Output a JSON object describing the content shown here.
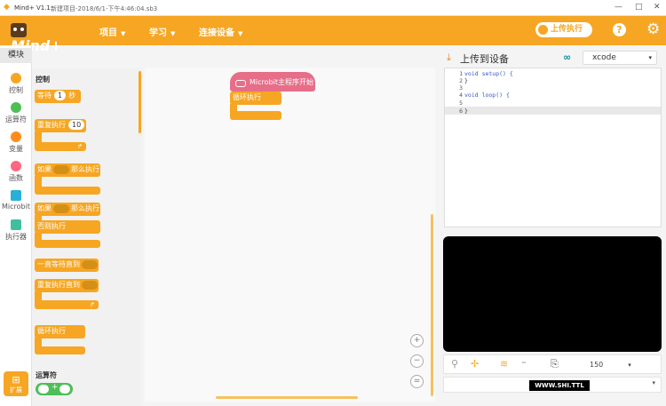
{
  "window": {
    "app_title": "Mind+ V1.1",
    "project_title": "新建项目-2018/6/1-下午4:46:04.sb3",
    "controls": [
      "—",
      "□",
      "✕"
    ]
  },
  "menubar": {
    "logo_text": "Mind+",
    "menus": [
      "项目",
      "学习",
      "连接设备"
    ],
    "upload_toggle_label": "上传执行",
    "help_label": "?",
    "settings_icon": "gear-icon"
  },
  "categories": {
    "modules_tab": "模块",
    "items": [
      {
        "label": "控制",
        "color": "#f6a623"
      },
      {
        "label": "运算符",
        "color": "#4cbf56"
      },
      {
        "label": "变量",
        "color": "#ff8c1a"
      },
      {
        "label": "函数",
        "color": "#ff6680"
      },
      {
        "label": "Microbit",
        "color": "#29b0d9"
      },
      {
        "label": "执行器",
        "color": "#40bfa0"
      }
    ],
    "extension_label": "扩展"
  },
  "palette": {
    "section_control": "控制",
    "wait": {
      "prefix": "等待",
      "value": "1",
      "suffix": "秒"
    },
    "repeat": {
      "prefix": "重复执行",
      "value": "10"
    },
    "if_then": {
      "prefix": "如果",
      "suffix": "那么执行"
    },
    "if_else": {
      "prefix": "如果",
      "suffix": "那么执行",
      "else": "否则执行"
    },
    "wait_until": "一直等待直到",
    "repeat_until": "重复执行直到",
    "forever": "循环执行",
    "section_operators": "运算符",
    "plus_label": "+"
  },
  "workspace": {
    "hat_label": "Microbit主程序开始",
    "loop_label": "循环执行",
    "zoom_in": "+",
    "zoom_out": "−",
    "zoom_reset": "="
  },
  "code_panel": {
    "title": "上传到设备",
    "board_select": "xcode",
    "lines": [
      {
        "n": "1",
        "text": "void setup() {"
      },
      {
        "n": "2",
        "text": "}"
      },
      {
        "n": "3",
        "text": ""
      },
      {
        "n": "4",
        "text": "void loop() {"
      },
      {
        "n": "5",
        "text": ""
      },
      {
        "n": "6",
        "text": "}"
      }
    ]
  },
  "serial": {
    "baud_partial": "150",
    "overlay": "WWW.SHI.TTL"
  }
}
